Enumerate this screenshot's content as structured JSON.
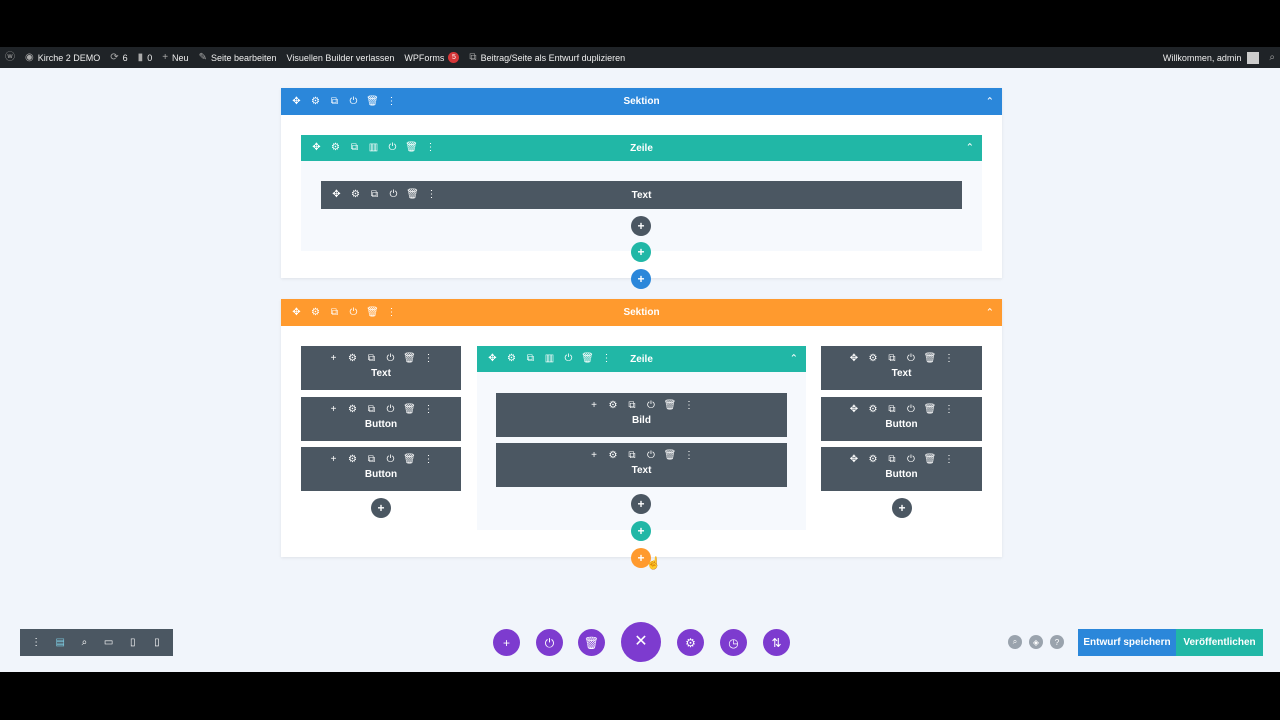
{
  "admin_bar": {
    "site_name": "Kirche 2 DEMO",
    "updates_count": "6",
    "comments_count": "0",
    "new_label": "Neu",
    "edit_page_label": "Seite bearbeiten",
    "exit_builder_label": "Visuellen Builder verlassen",
    "wpforms_label": "WPForms",
    "wpforms_badge": "5",
    "duplicate_label": "Beitrag/Seite als Entwurf duplizieren",
    "welcome_label": "Willkommen, admin"
  },
  "sections": [
    {
      "label": "Sektion",
      "color": "#2b87da",
      "row": {
        "label": "Zeile",
        "modules": [
          {
            "label": "Text"
          }
        ]
      }
    },
    {
      "label": "Sektion",
      "color": "#ff9a2e",
      "columns": {
        "left": [
          {
            "label": "Text"
          },
          {
            "label": "Button"
          },
          {
            "label": "Button"
          }
        ],
        "center_row": {
          "label": "Zeile",
          "modules": [
            {
              "label": "Bild"
            },
            {
              "label": "Text"
            }
          ]
        },
        "right": [
          {
            "label": "Text"
          },
          {
            "label": "Button"
          },
          {
            "label": "Button"
          }
        ]
      }
    }
  ],
  "icons": {
    "move": "✥",
    "settings": "⚙",
    "duplicate": "⧉",
    "columns": "▥",
    "power": "⏻",
    "trash": "🗑",
    "more": "⋮",
    "plus": "+",
    "collapse": "⌃",
    "close": "✕"
  },
  "colors": {
    "section_blue": "#2b87da",
    "section_orange": "#ff9a2e",
    "row_teal": "#21b7a6",
    "module_gray": "#4b5762",
    "fab_purple": "#7d3bcf"
  },
  "footer": {
    "save_draft_label": "Entwurf speichern",
    "publish_label": "Veröffentlichen"
  }
}
